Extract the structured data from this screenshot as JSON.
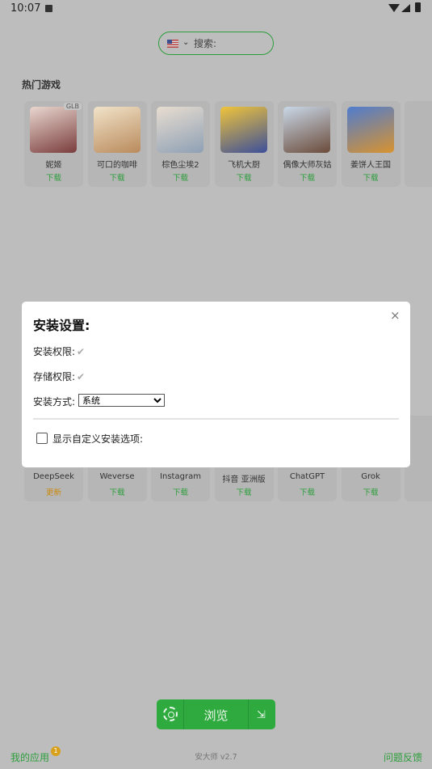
{
  "status_bar": {
    "time": "10:07"
  },
  "search": {
    "placeholder": "搜索:"
  },
  "hot_games": {
    "title": "热门游戏",
    "items": [
      {
        "name": "妮姬",
        "action": "下载",
        "badge": "GLB",
        "colors": [
          "#7a3d3d",
          "#e9d7cf"
        ]
      },
      {
        "name": "可口的咖啡",
        "action": "下载",
        "colors": [
          "#b98a5c",
          "#f1e3c9"
        ]
      },
      {
        "name": "棕色尘埃2",
        "action": "下载",
        "colors": [
          "#8ea0b5",
          "#e8ddd0"
        ]
      },
      {
        "name": "飞机大厨",
        "action": "下载",
        "colors": [
          "#3c4f9a",
          "#f0c43a"
        ]
      },
      {
        "name": "偶像大师灰姑",
        "action": "下载",
        "colors": [
          "#6b4b3a",
          "#c9d8e8"
        ]
      },
      {
        "name": "姜饼人王国",
        "action": "下载",
        "colors": [
          "#d8932f",
          "#4f7ccf"
        ]
      }
    ]
  },
  "apps": {
    "items": [
      {
        "name": "DeepSeek",
        "action": "更新",
        "update": true
      },
      {
        "name": "Weverse",
        "action": "下载"
      },
      {
        "name": "Instagram",
        "action": "下载"
      },
      {
        "name": "抖音 亚洲版",
        "action": "下载"
      },
      {
        "name": "ChatGPT",
        "action": "下载"
      },
      {
        "name": "Grok",
        "action": "下载"
      }
    ]
  },
  "dialog": {
    "title": "安装设置:",
    "close_label": "×",
    "install_permission_label": "安装权限:",
    "storage_permission_label": "存储权限:",
    "check_mark": "✔",
    "install_method_label": "安装方式:",
    "install_method_value": "系统",
    "custom_options_label": "显示自定义安装选项:"
  },
  "bottom": {
    "browse_label": "浏览",
    "my_apps_label": "我的应用",
    "my_apps_badge": "1",
    "version": "安大师 v2.7",
    "feedback_label": "问题反馈"
  }
}
